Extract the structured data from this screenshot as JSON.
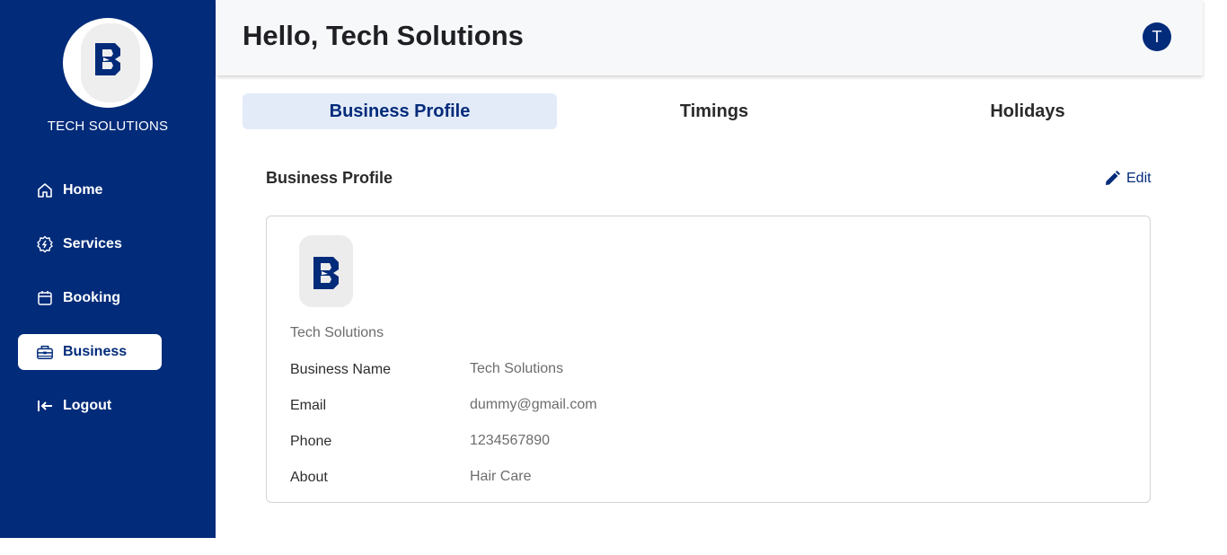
{
  "brand": {
    "name": "TECH SOLUTIONS",
    "logo_icon": "b-logo-icon"
  },
  "colors": {
    "primary": "#022b7a",
    "tab_active_bg": "#e3ebf9",
    "header_bg": "#f7f8fa"
  },
  "sidebar": {
    "items": [
      {
        "label": "Home",
        "icon": "home-icon",
        "active": false
      },
      {
        "label": "Services",
        "icon": "services-gear-icon",
        "active": false
      },
      {
        "label": "Booking",
        "icon": "calendar-icon",
        "active": false
      },
      {
        "label": "Business",
        "icon": "briefcase-icon",
        "active": true
      },
      {
        "label": "Logout",
        "icon": "logout-icon",
        "active": false
      }
    ]
  },
  "header": {
    "title": "Hello, Tech Solutions",
    "avatar_initial": "T"
  },
  "tabs": [
    {
      "label": "Business Profile",
      "active": true
    },
    {
      "label": "Timings",
      "active": false
    },
    {
      "label": "Holidays",
      "active": false
    }
  ],
  "section": {
    "title": "Business Profile",
    "edit_label": "Edit"
  },
  "profile": {
    "display_name": "Tech Solutions",
    "fields": [
      {
        "label": "Business Name",
        "value": "Tech Solutions"
      },
      {
        "label": "Email",
        "value": "dummy@gmail.com"
      },
      {
        "label": "Phone",
        "value": "1234567890"
      },
      {
        "label": "About",
        "value": "Hair Care"
      }
    ]
  }
}
